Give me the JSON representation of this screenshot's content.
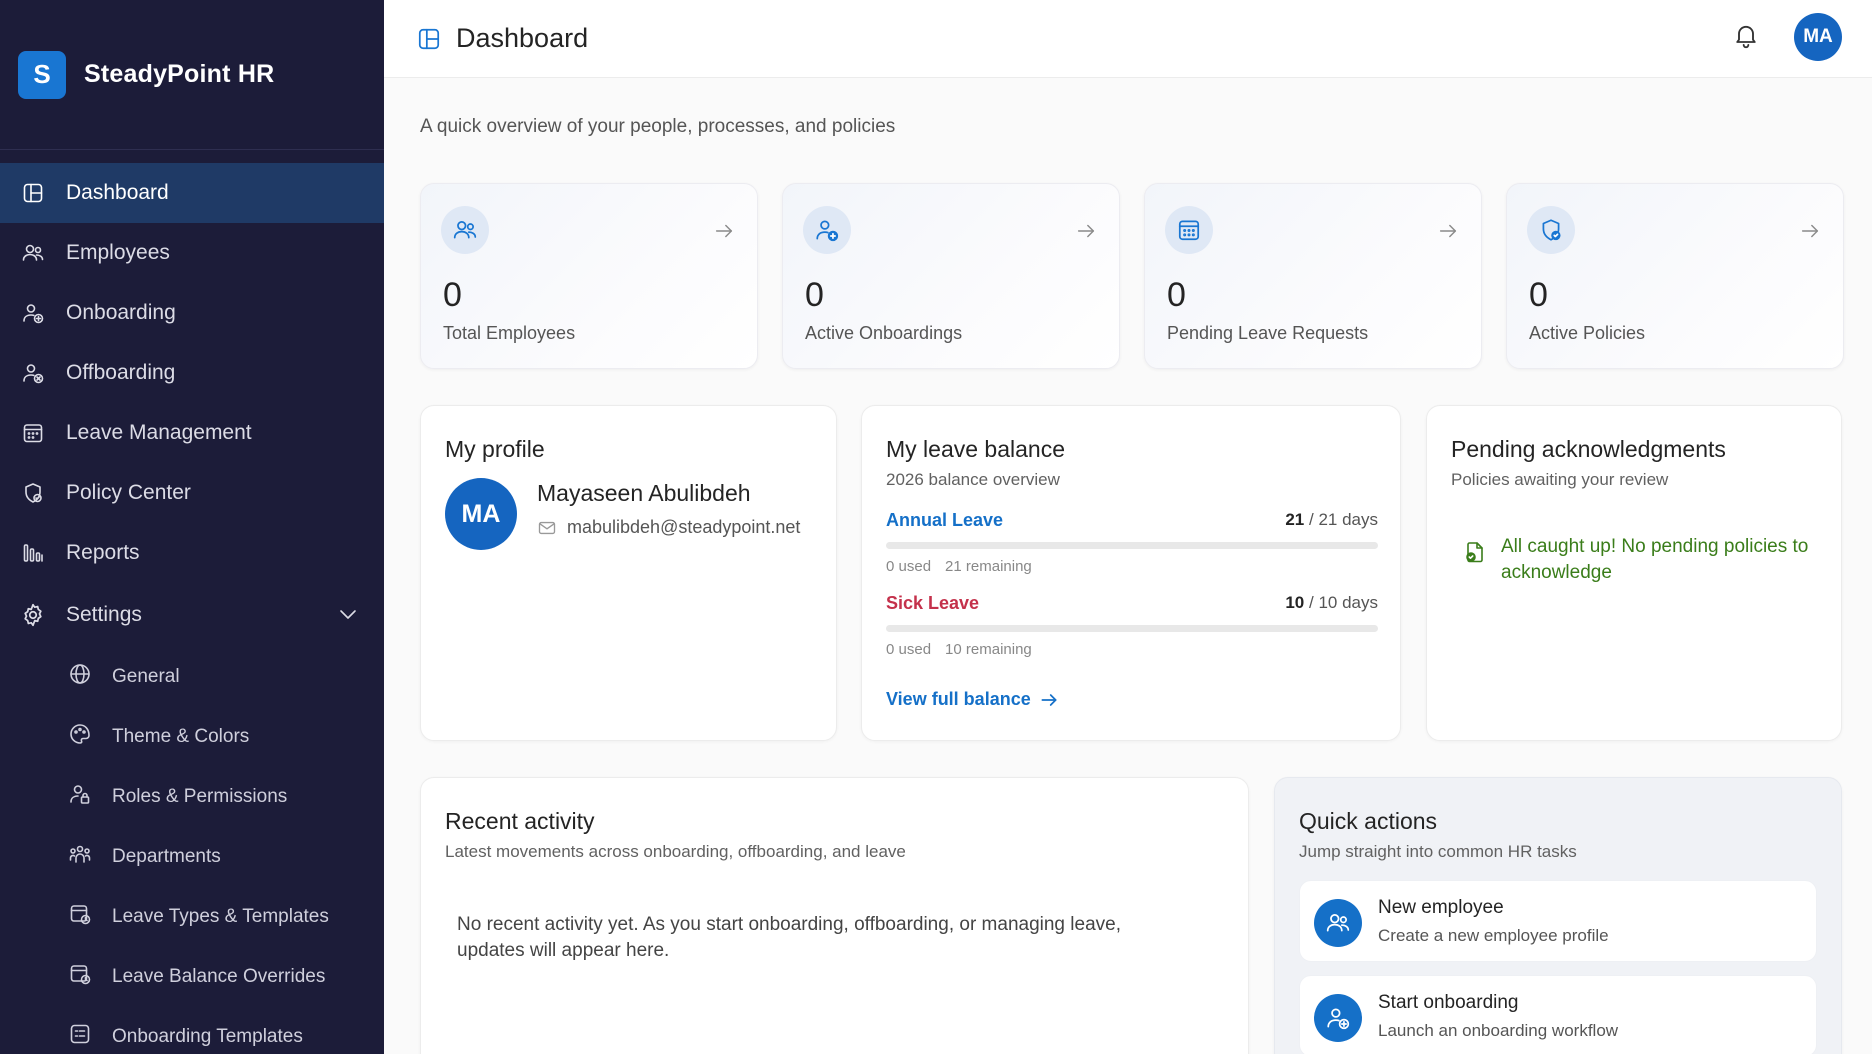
{
  "brand": {
    "logo_letter": "S",
    "name": "SteadyPoint HR",
    "accent": "#1976d2"
  },
  "sidebar": {
    "items": [
      {
        "label": "Dashboard",
        "icon": "dashboard-icon",
        "active": true
      },
      {
        "label": "Employees",
        "icon": "people-icon"
      },
      {
        "label": "Onboarding",
        "icon": "person-add-icon"
      },
      {
        "label": "Offboarding",
        "icon": "person-remove-icon"
      },
      {
        "label": "Leave Management",
        "icon": "calendar-icon"
      },
      {
        "label": "Policy Center",
        "icon": "shield-icon"
      },
      {
        "label": "Reports",
        "icon": "bar-chart-icon"
      },
      {
        "label": "Settings",
        "icon": "gear-icon",
        "expanded": true
      }
    ],
    "settings_children": [
      {
        "label": "General",
        "icon": "globe-icon"
      },
      {
        "label": "Theme & Colors",
        "icon": "palette-icon"
      },
      {
        "label": "Roles & Permissions",
        "icon": "person-lock-icon"
      },
      {
        "label": "Departments",
        "icon": "team-icon"
      },
      {
        "label": "Leave Types & Templates",
        "icon": "calendar-clock-icon"
      },
      {
        "label": "Leave Balance Overrides",
        "icon": "calendar-clock-icon"
      },
      {
        "label": "Onboarding Templates",
        "icon": "template-icon"
      }
    ]
  },
  "header": {
    "title": "Dashboard",
    "avatar_initials": "MA"
  },
  "subtitle": "A quick overview of your people, processes, and policies",
  "stats": [
    {
      "value": "0",
      "label": "Total Employees",
      "icon": "people-icon"
    },
    {
      "value": "0",
      "label": "Active Onboardings",
      "icon": "person-add-icon"
    },
    {
      "value": "0",
      "label": "Pending Leave Requests",
      "icon": "calendar-icon"
    },
    {
      "value": "0",
      "label": "Active Policies",
      "icon": "shield-check-icon"
    }
  ],
  "profile": {
    "title": "My profile",
    "initials": "MA",
    "name": "Mayaseen Abulibdeh",
    "email": "mabulibdeh@steadypoint.net"
  },
  "leave_balance": {
    "title": "My leave balance",
    "subtitle": "2026 balance overview",
    "types": [
      {
        "name": "Annual Leave",
        "color": "#1570c8",
        "available": "21",
        "total": "/ 21 days",
        "used": "0 used",
        "remaining": "21 remaining",
        "used_fraction": 0
      },
      {
        "name": "Sick Leave",
        "color": "#c4314b",
        "available": "10",
        "total": "/ 10 days",
        "used": "0 used",
        "remaining": "10 remaining",
        "used_fraction": 0
      }
    ],
    "link": "View full balance"
  },
  "acknowledgments": {
    "title": "Pending acknowledgments",
    "subtitle": "Policies awaiting your review",
    "empty": "All caught up! No pending policies to acknowledge",
    "success_color": "#3a7d1a"
  },
  "activity": {
    "title": "Recent activity",
    "subtitle": "Latest movements across onboarding, offboarding, and leave",
    "empty": "No recent activity yet. As you start onboarding, offboarding, or managing leave, updates will appear here."
  },
  "quick_actions": {
    "title": "Quick actions",
    "subtitle": "Jump straight into common HR tasks",
    "items": [
      {
        "title": "New employee",
        "desc": "Create a new employee profile",
        "icon": "people-icon"
      },
      {
        "title": "Start onboarding",
        "desc": "Launch an onboarding workflow",
        "icon": "person-add-icon"
      }
    ]
  }
}
